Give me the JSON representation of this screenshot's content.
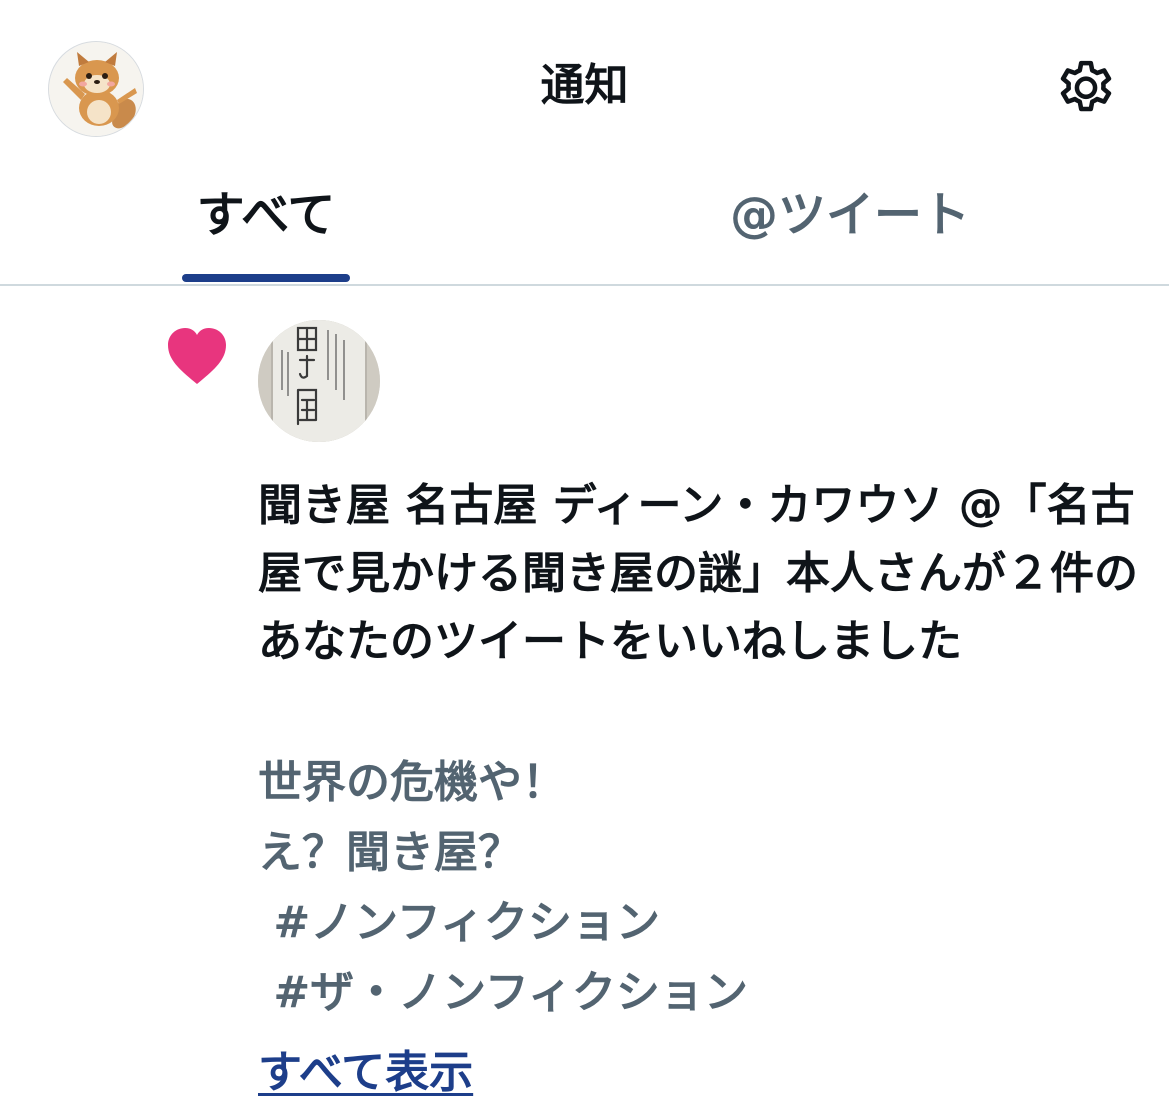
{
  "header": {
    "title": "通知",
    "avatar_icon": "squirrel-avatar-icon",
    "settings_icon": "gear-icon"
  },
  "tabs": [
    {
      "label": "すべて",
      "active": true
    },
    {
      "label": "@ツイート",
      "active": false
    }
  ],
  "notification": {
    "type_icon": "heart-icon",
    "type_color": "#e8357e",
    "avatar_icon": "kikiya-sign-avatar",
    "message": "聞き屋 名古屋 ディーン・カワウソ @「名古屋で見かける聞き屋の謎」本人さんが２件のあなたのツイートをいいねしました",
    "tweet_lines": [
      "世界の危機や！",
      "え？聞き屋？",
      " #ノンフィクション",
      " #ザ・ノンフィクション"
    ],
    "show_all_label": "すべて表示"
  },
  "colors": {
    "accent": "#1d3e8a",
    "secondary_text": "#536471",
    "primary_text": "#0f1419",
    "like": "#e8357e"
  }
}
